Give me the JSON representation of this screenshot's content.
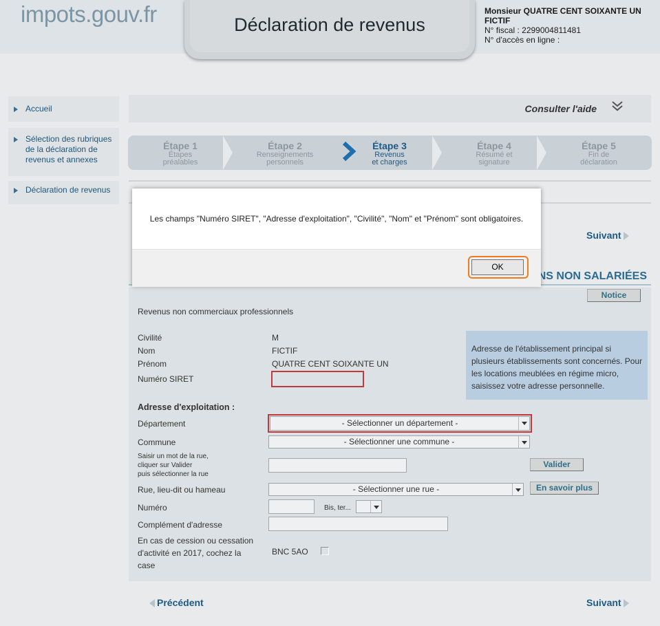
{
  "header": {
    "logo": "impots.gouv.fr",
    "title": "Déclaration de revenus",
    "user_name": "Monsieur QUATRE CENT SOIXANTE UN FICTIF",
    "fiscal_number": "N° fiscal : 2299004811481",
    "online_access": "N° d'accès en ligne :"
  },
  "sidebar": {
    "items": [
      {
        "label": "Accueil"
      },
      {
        "label": "Sélection des rubriques de la déclaration de revenus et annexes"
      },
      {
        "label": "Déclaration de revenus"
      }
    ]
  },
  "help": {
    "label": "Consulter l'aide"
  },
  "steps": [
    {
      "number": "Étape 1",
      "line1": "Étapes",
      "line2": "préalables"
    },
    {
      "number": "Étape 2",
      "line1": "Renseignements",
      "line2": "personnels"
    },
    {
      "number": "Étape 3",
      "line1": "Revenus",
      "line2": "et charges"
    },
    {
      "number": "Étape 4",
      "line1": "Résumé et",
      "line2": "signature"
    },
    {
      "number": "Étape 5",
      "line1": "Fin de",
      "line2": "déclaration"
    }
  ],
  "nav": {
    "next": "Suivant",
    "previous": "Précédent"
  },
  "section": {
    "title_visible": "NS NON SALARIÉES",
    "notice": "Notice"
  },
  "form": {
    "subtitle": "Revenus non commerciaux professionnels",
    "civilite_label": "Civilité",
    "civilite_value": "M",
    "nom_label": "Nom",
    "nom_value": "FICTIF",
    "prenom_label": "Prénom",
    "prenom_value": "QUATRE CENT SOIXANTE UN",
    "siret_label": "Numéro SIRET",
    "address_heading": "Adresse d'exploitation :",
    "departement_label": "Département",
    "departement_select": "- Sélectionner un département -",
    "commune_label": "Commune",
    "commune_select": "- Sélectionner une commune -",
    "street_hint_1": "Saisir un mot de la rue,",
    "street_hint_2": "cliquer sur Valider",
    "street_hint_3": "puis sélectionner la rue",
    "validate_button": "Valider",
    "rue_label": "Rue, lieu-dit ou hameau",
    "rue_select": "- Sélectionner une rue -",
    "more_button": "En savoir plus",
    "numero_label": "Numéro",
    "bis_label": "Bis, ter...",
    "complement_label": "Complément d'adresse",
    "cession_line1": "En cas de cession ou cessation",
    "cession_line2": "d'activité en 2017, cochez la",
    "cession_line3": "case",
    "bnc_label": "BNC 5AO",
    "info_text": "Adresse de l'établissement principal si plusieurs établissements sont concernés. Pour les locations meublées en régime micro, saisissez votre adresse personnelle."
  },
  "modal": {
    "message": "Les champs \"Numéro SIRET\", \"Adresse d'exploitation\", \"Civilité\", \"Nom\" et \"Prénom\" sont obligatoires.",
    "ok_label": "OK"
  },
  "colors": {
    "accent": "#1d5a86",
    "error": "#c0393b",
    "focus_ring": "#ef7d1f"
  }
}
